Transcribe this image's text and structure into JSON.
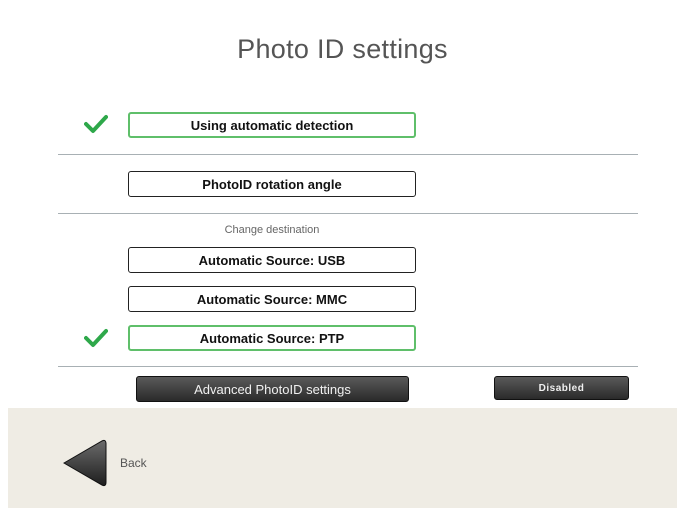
{
  "header": {
    "title": "Photo ID settings"
  },
  "detection": {
    "label": "Using automatic detection",
    "selected": true
  },
  "rotation": {
    "label": "PhotoID rotation angle"
  },
  "destination": {
    "heading": "Change destination",
    "options": [
      {
        "label": "Automatic Source: USB",
        "selected": false
      },
      {
        "label": "Automatic Source: MMC",
        "selected": false
      },
      {
        "label": "Automatic Source: PTP",
        "selected": true
      }
    ]
  },
  "advanced": {
    "label": "Advanced PhotoID settings",
    "status": "Disabled"
  },
  "footer": {
    "back_label": "Back"
  },
  "icons": {
    "check": "checkmark-icon",
    "back": "back-arrow-icon"
  },
  "colors": {
    "selected_border": "#5fbf6a",
    "check": "#2ea84a",
    "footer_bg": "#efece4"
  }
}
